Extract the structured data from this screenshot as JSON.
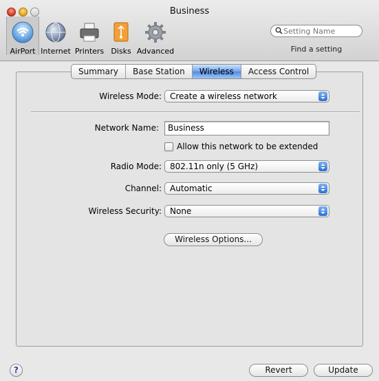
{
  "window": {
    "title": "Business"
  },
  "toolbar": {
    "items": [
      {
        "label": "AirPort",
        "icon": "airport-icon",
        "selected": true
      },
      {
        "label": "Internet",
        "icon": "globe-icon",
        "selected": false
      },
      {
        "label": "Printers",
        "icon": "printer-icon",
        "selected": false
      },
      {
        "label": "Disks",
        "icon": "disk-icon",
        "selected": false
      },
      {
        "label": "Advanced",
        "icon": "gear-icon",
        "selected": false
      }
    ],
    "search_placeholder": "Setting Name",
    "find_label": "Find a setting"
  },
  "tabs": [
    {
      "label": "Summary",
      "active": false
    },
    {
      "label": "Base Station",
      "active": false
    },
    {
      "label": "Wireless",
      "active": true
    },
    {
      "label": "Access Control",
      "active": false
    }
  ],
  "form": {
    "wireless_mode_label": "Wireless Mode:",
    "wireless_mode_value": "Create a wireless network",
    "network_name_label": "Network Name:",
    "network_name_value": "Business",
    "allow_extend_label": "Allow this network to be extended",
    "allow_extend_checked": false,
    "radio_mode_label": "Radio Mode:",
    "radio_mode_value": "802.11n only (5 GHz)",
    "channel_label": "Channel:",
    "channel_value": "Automatic",
    "security_label": "Wireless Security:",
    "security_value": "None",
    "options_button": "Wireless Options..."
  },
  "footer": {
    "help_glyph": "?",
    "revert_button": "Revert",
    "update_button": "Update"
  },
  "colors": {
    "accent": "#4f8ae0",
    "panel": "#e4e4e4"
  }
}
